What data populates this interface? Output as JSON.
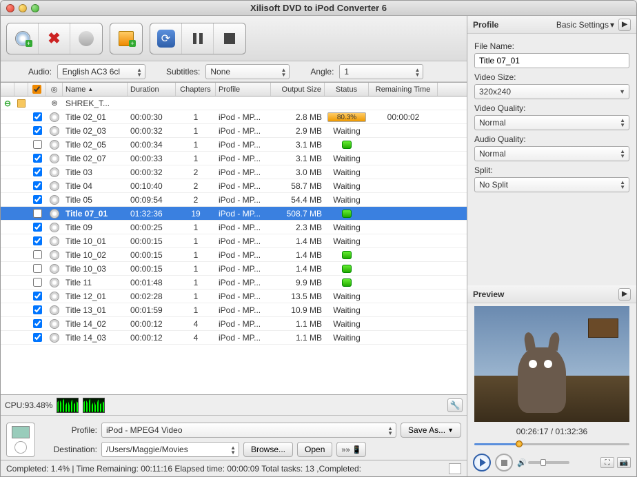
{
  "window": {
    "title": "Xilisoft DVD to iPod Converter 6"
  },
  "options": {
    "audio_label": "Audio:",
    "audio_value": "English AC3 6cl",
    "subs_label": "Subtitles:",
    "subs_value": "None",
    "angle_label": "Angle:",
    "angle_value": "1"
  },
  "columns": {
    "name": "Name",
    "duration": "Duration",
    "chapters": "Chapters",
    "profile": "Profile",
    "output_size": "Output Size",
    "status": "Status",
    "remaining": "Remaining Time"
  },
  "root": {
    "name": "SHREK_T..."
  },
  "rows": [
    {
      "checked": true,
      "name": "Title 02_01",
      "duration": "00:00:30",
      "chapters": "1",
      "profile": "iPod - MP...",
      "size": "2.8 MB",
      "status": "progress",
      "percent": "80.3%",
      "remaining": "00:00:02"
    },
    {
      "checked": true,
      "name": "Title 02_03",
      "duration": "00:00:32",
      "chapters": "1",
      "profile": "iPod - MP...",
      "size": "2.9 MB",
      "status": "Waiting"
    },
    {
      "checked": false,
      "name": "Title 02_05",
      "duration": "00:00:34",
      "chapters": "1",
      "profile": "iPod - MP...",
      "size": "3.1 MB",
      "status": "green"
    },
    {
      "checked": true,
      "name": "Title 02_07",
      "duration": "00:00:33",
      "chapters": "1",
      "profile": "iPod - MP...",
      "size": "3.1 MB",
      "status": "Waiting"
    },
    {
      "checked": true,
      "name": "Title 03",
      "duration": "00:00:32",
      "chapters": "2",
      "profile": "iPod - MP...",
      "size": "3.0 MB",
      "status": "Waiting"
    },
    {
      "checked": true,
      "name": "Title 04",
      "duration": "00:10:40",
      "chapters": "2",
      "profile": "iPod - MP...",
      "size": "58.7 MB",
      "status": "Waiting"
    },
    {
      "checked": true,
      "name": "Title 05",
      "duration": "00:09:54",
      "chapters": "2",
      "profile": "iPod - MP...",
      "size": "54.4 MB",
      "status": "Waiting"
    },
    {
      "checked": false,
      "name": "Title 07_01",
      "duration": "01:32:36",
      "chapters": "19",
      "profile": "iPod - MP...",
      "size": "508.7 MB",
      "status": "green",
      "selected": true
    },
    {
      "checked": true,
      "name": "Title 09",
      "duration": "00:00:25",
      "chapters": "1",
      "profile": "iPod - MP...",
      "size": "2.3 MB",
      "status": "Waiting"
    },
    {
      "checked": true,
      "name": "Title 10_01",
      "duration": "00:00:15",
      "chapters": "1",
      "profile": "iPod - MP...",
      "size": "1.4 MB",
      "status": "Waiting"
    },
    {
      "checked": false,
      "name": "Title 10_02",
      "duration": "00:00:15",
      "chapters": "1",
      "profile": "iPod - MP...",
      "size": "1.4 MB",
      "status": "green"
    },
    {
      "checked": false,
      "name": "Title 10_03",
      "duration": "00:00:15",
      "chapters": "1",
      "profile": "iPod - MP...",
      "size": "1.4 MB",
      "status": "green"
    },
    {
      "checked": false,
      "name": "Title 11",
      "duration": "00:01:48",
      "chapters": "1",
      "profile": "iPod - MP...",
      "size": "9.9 MB",
      "status": "green"
    },
    {
      "checked": true,
      "name": "Title 12_01",
      "duration": "00:02:28",
      "chapters": "1",
      "profile": "iPod - MP...",
      "size": "13.5 MB",
      "status": "Waiting"
    },
    {
      "checked": true,
      "name": "Title 13_01",
      "duration": "00:01:59",
      "chapters": "1",
      "profile": "iPod - MP...",
      "size": "10.9 MB",
      "status": "Waiting"
    },
    {
      "checked": true,
      "name": "Title 14_02",
      "duration": "00:00:12",
      "chapters": "4",
      "profile": "iPod - MP...",
      "size": "1.1 MB",
      "status": "Waiting"
    },
    {
      "checked": true,
      "name": "Title 14_03",
      "duration": "00:00:12",
      "chapters": "4",
      "profile": "iPod - MP...",
      "size": "1.1 MB",
      "status": "Waiting"
    }
  ],
  "cpu": {
    "label": "CPU:93.48%"
  },
  "bottom": {
    "profile_label": "Profile:",
    "profile_value": "iPod - MPEG4 Video",
    "saveas": "Save As...",
    "dest_label": "Destination:",
    "dest_value": "/Users/Maggie/Movies",
    "browse": "Browse...",
    "open": "Open"
  },
  "statusbar": "Completed: 1.4% | Time Remaining: 00:11:16 Elapsed time: 00:00:09 Total tasks: 13 ,Completed:",
  "profile_panel": {
    "title": "Profile",
    "basic": "Basic Settings",
    "filename_label": "File Name:",
    "filename_value": "Title 07_01",
    "videosize_label": "Video Size:",
    "videosize_value": "320x240",
    "videoq_label": "Video Quality:",
    "videoq_value": "Normal",
    "audioq_label": "Audio Quality:",
    "audioq_value": "Normal",
    "split_label": "Split:",
    "split_value": "No Split"
  },
  "preview": {
    "title": "Preview",
    "time": "00:26:17 / 01:32:36"
  }
}
